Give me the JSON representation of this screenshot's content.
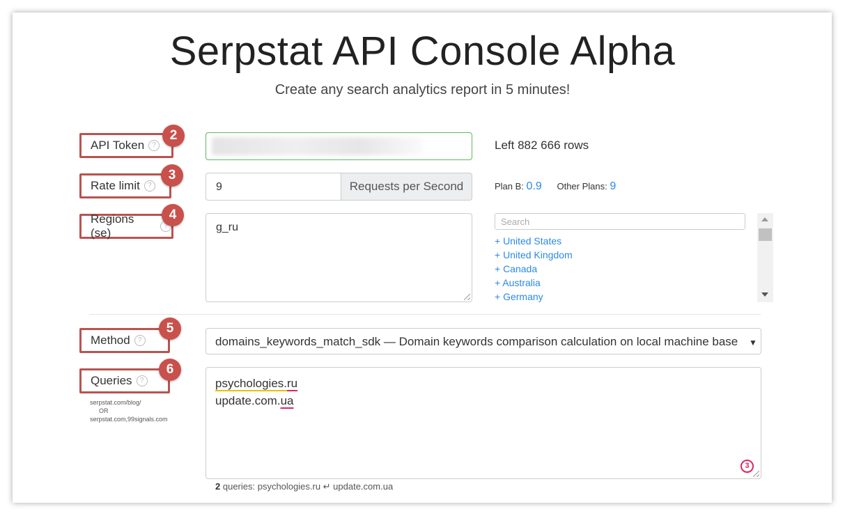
{
  "header": {
    "title": "Serpstat API Console Alpha",
    "subtitle": "Create any search analytics report in 5 minutes!"
  },
  "fields": {
    "api_token": {
      "label": "API Token",
      "badge": "2",
      "value": "",
      "rows_left": "Left 882 666 rows"
    },
    "rate_limit": {
      "label": "Rate limit",
      "badge": "3",
      "value": "9",
      "addon": "Requests per Second",
      "plan_b_label": "Plan B:",
      "plan_b_value": "0.9",
      "other_plans_label": "Other Plans:",
      "other_plans_value": "9"
    },
    "regions": {
      "label": "Regions (se)",
      "badge": "4",
      "value": "g_ru",
      "search_placeholder": "Search",
      "options": [
        "+ United States",
        "+ United Kingdom",
        "+ Canada",
        "+ Australia",
        "+ Germany"
      ]
    },
    "method": {
      "label": "Method",
      "badge": "5",
      "selected": "domains_keywords_match_sdk — Domain keywords comparison calculation on local machine base"
    },
    "queries": {
      "label": "Queries",
      "badge": "6",
      "lines": [
        "psychologies.",
        "ru",
        "update.com.",
        "ua"
      ],
      "hint_line1": "serpstat.com/blog/",
      "hint_line2": "OR",
      "hint_line3": "serpstat.com,99signals.com",
      "summary_count": "2",
      "summary_text": "queries: psychologies.ru ↵ update.com.ua",
      "grammar_count": "3"
    }
  },
  "help_glyph": "?",
  "colors": {
    "accent_red": "#b9534f",
    "link_blue": "#2a8ae6",
    "valid_green": "#5cb85c"
  }
}
